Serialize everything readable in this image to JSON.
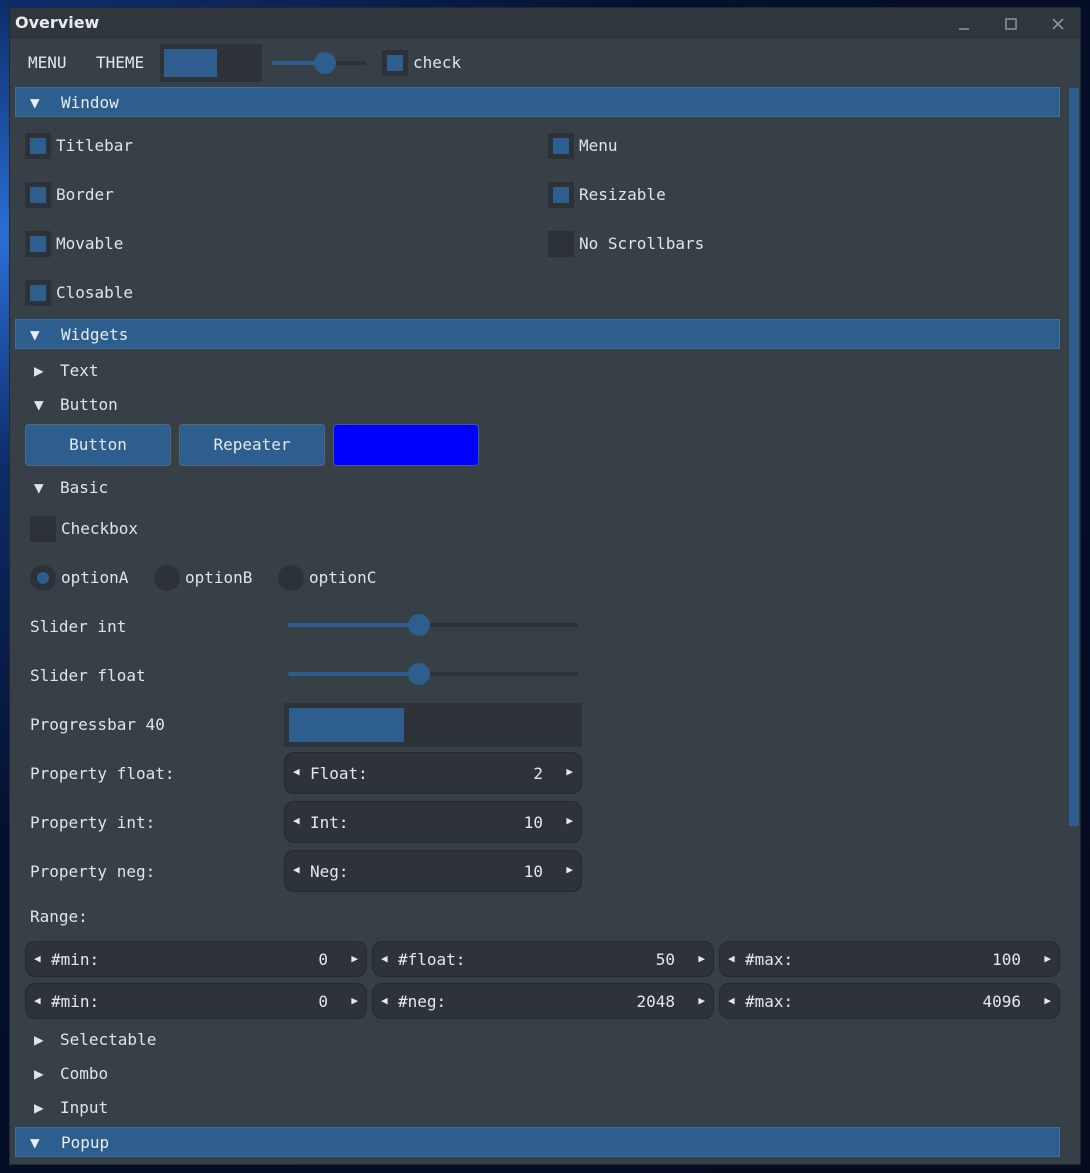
{
  "window": {
    "title": "Overview"
  },
  "menubar": {
    "menu_label": "MENU",
    "theme_label": "THEME",
    "progress_value": 0.56,
    "slider_value": 0.56,
    "check_label": "check",
    "check_checked": true
  },
  "sections": {
    "window_header": "Window",
    "widgets_header": "Widgets",
    "popup_header": "Popup"
  },
  "window_options": {
    "titlebar": "Titlebar",
    "menu": "Menu",
    "border": "Border",
    "resizable": "Resizable",
    "movable": "Movable",
    "no_scrollbars": "No Scrollbars",
    "closable": "Closable"
  },
  "tree": {
    "text": "Text",
    "button": "Button",
    "basic": "Basic",
    "selectable": "Selectable",
    "combo": "Combo",
    "input": "Input"
  },
  "buttons": {
    "button_label": "Button",
    "repeater_label": "Repeater",
    "color_button_color": "#0000ff"
  },
  "basic": {
    "checkbox_label": "Checkbox",
    "option_a": "optionA",
    "option_b": "optionB",
    "option_c": "optionC",
    "slider_int_label": "Slider int",
    "slider_int_value": 0.45,
    "slider_float_label": "Slider float",
    "slider_float_value": 0.45,
    "progress_label": "Progressbar 40",
    "progress_value": 0.4,
    "prop_float_label": "Property float:",
    "prop_float_name": "Float:",
    "prop_float_value": "2",
    "prop_int_label": "Property int:",
    "prop_int_name": "Int:",
    "prop_int_value": "10",
    "prop_neg_label": "Property neg:",
    "prop_neg_name": "Neg:",
    "prop_neg_value": "10",
    "range_label": "Range:",
    "range_row1": [
      {
        "name": "#min:",
        "value": "0"
      },
      {
        "name": "#float:",
        "value": "50"
      },
      {
        "name": "#max:",
        "value": "100"
      }
    ],
    "range_row2": [
      {
        "name": "#min:",
        "value": "0"
      },
      {
        "name": "#neg:",
        "value": "2048"
      },
      {
        "name": "#max:",
        "value": "4096"
      }
    ]
  },
  "glyphs": {
    "expanded": "▼",
    "collapsed": "▶",
    "left": "◀",
    "right": "▶"
  },
  "colors": {
    "accent": "#2d5e8d",
    "window_bg": "#384047",
    "field_bg": "#2d3338"
  }
}
